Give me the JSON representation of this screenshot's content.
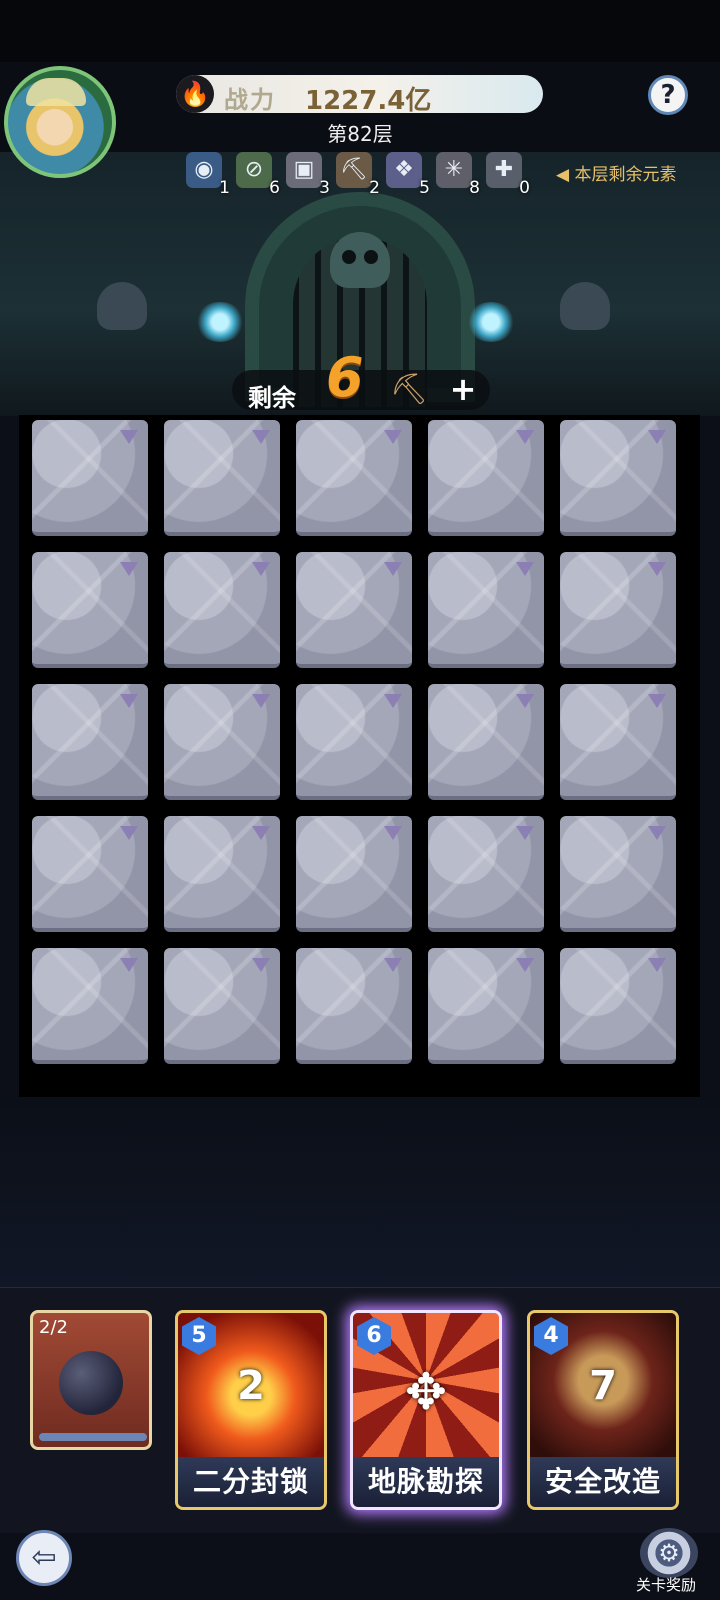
{
  "header": {
    "power_label": "战力",
    "power_value": "1227.4亿",
    "floor_label": "第82层",
    "help_label": "?"
  },
  "elements": [
    {
      "icon": "portal-icon",
      "glyph": "◉",
      "count": "1",
      "color": "#3a5b86"
    },
    {
      "icon": "forbidden-icon",
      "glyph": "⊘",
      "count": "6",
      "color": "#4d6b4a"
    },
    {
      "icon": "locked-chest-icon",
      "glyph": "▣",
      "count": "3",
      "color": "#6b6b7a"
    },
    {
      "icon": "pickaxe-icon",
      "glyph": "⛏",
      "count": "2",
      "color": "#6a5a46"
    },
    {
      "icon": "crystal-icon",
      "glyph": "❖",
      "count": "5",
      "color": "#5b5f8a"
    },
    {
      "icon": "spiderweb-icon",
      "glyph": "✳",
      "count": "8",
      "color": "#5f5f6a"
    },
    {
      "icon": "puzzle-icon",
      "glyph": "✚",
      "count": "0",
      "color": "#585f6a"
    }
  ],
  "remaining_elements_hint": "本层剩余元素",
  "pickaxes": {
    "label": "剩余",
    "count": "6",
    "add_label": "+"
  },
  "board": {
    "rows": 5,
    "cols": 5
  },
  "cards": {
    "bomb": {
      "count": "2/2"
    },
    "skills": [
      {
        "cost": "5",
        "number": "2",
        "name": "二分封锁",
        "selected": false
      },
      {
        "cost": "6",
        "number": "",
        "name": "地脉勘探",
        "selected": true
      },
      {
        "cost": "4",
        "number": "7",
        "name": "安全改造",
        "selected": false
      }
    ]
  },
  "footer": {
    "exit_glyph": "⇦",
    "reward_label": "关卡奖励"
  }
}
